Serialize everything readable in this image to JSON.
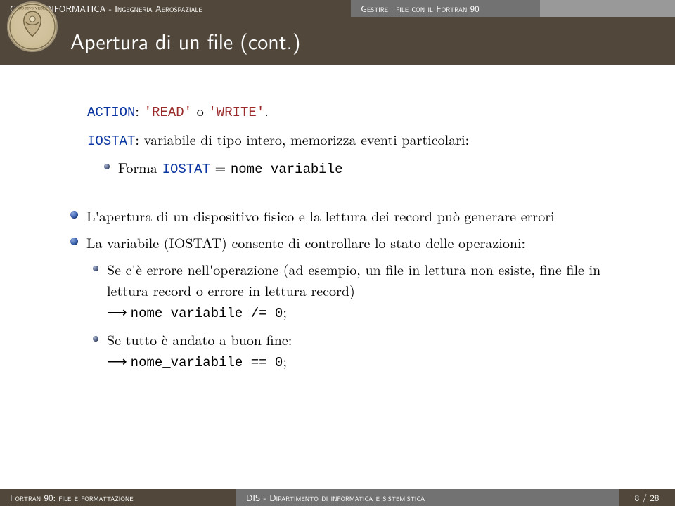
{
  "topbar": {
    "left": "Corso di INFORMATICA - Ingegneria Aerospaziale",
    "mid": "Gestire i file con il Fortran 90",
    "right": ""
  },
  "title": "Apertura di un file (cont.)",
  "line_action": {
    "kw": "ACTION",
    "mid": ": ",
    "s1": "'READ'",
    "between": " o ",
    "s2": "'WRITE'",
    "end": "."
  },
  "iostat": {
    "kw": "IOSTAT",
    "text": ": variabile di tipo intero, memorizza eventi particolari:",
    "sub_pre": "Forma ",
    "sub_kw": "IOSTAT",
    "sub_eq": " = ",
    "sub_tt": "nome_variabile"
  },
  "b1": "L'apertura di un dispositivo fisico e la lettura dei record può generare errori",
  "b2": "La variabile (IOSTAT) consente di controllare lo stato delle operazioni:",
  "b2a": {
    "text": "Se c'è errore nell'operazione (ad esempio, un file in lettura non esiste, fine file in lettura record o errore in lettura record)",
    "arrow": "→ ",
    "tt": "nome_variabile /= 0",
    "semi": ";"
  },
  "b2b": {
    "text": "Se tutto è andato a buon fine:",
    "arrow": "→ ",
    "tt": "nome_variabile == 0",
    "semi": ";"
  },
  "footer": {
    "left": "Fortran 90: file e formattazione",
    "mid": "DIS - Dipartimento di informatica e sistemistica",
    "right": "8 / 28"
  }
}
